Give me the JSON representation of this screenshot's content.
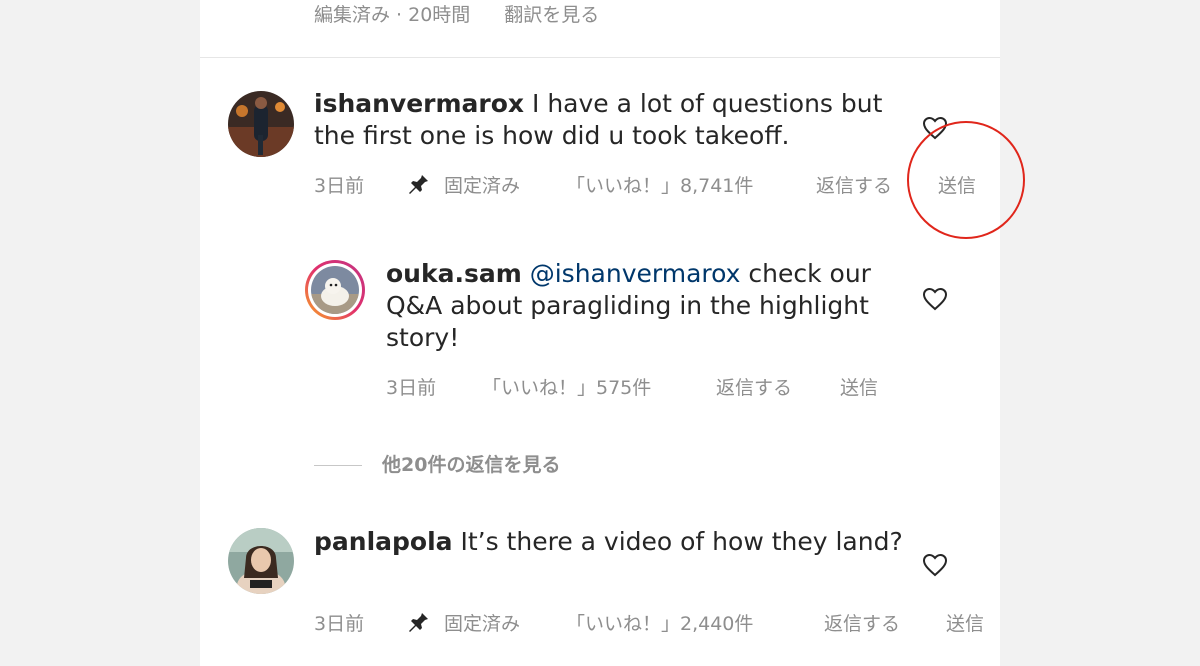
{
  "top_meta": {
    "edited": "編集済み · 20時間",
    "translate": "翻訳を見る"
  },
  "comments": [
    {
      "username": "ishanvermarox",
      "text": " I have a lot of questions but the first one is how did u took takeoff.",
      "time": "3日前",
      "pinned": "固定済み",
      "likes": "「いいね！」8,741件",
      "reply": "返信する",
      "send": "送信"
    },
    {
      "username": "panlapola",
      "text": " It’s there a video of how they land?",
      "time": "3日前",
      "pinned": "固定済み",
      "likes": "「いいね！」2,440件",
      "reply": "返信する",
      "send": "送信"
    }
  ],
  "reply": {
    "username": "ouka.sam",
    "mention": "@ishanvermarox",
    "text": " check our Q&A about paragliding in the highlight story!",
    "time": "3日前",
    "likes": "「いいね！」575件",
    "reply": "返信する",
    "send": "送信"
  },
  "view_more_replies": "他20件の返信を見る",
  "colors": {
    "text": "#262626",
    "meta": "#8e8e8e",
    "mention": "#00376b",
    "highlight": "#e0261b",
    "story_ring_start": "#f9a825",
    "story_ring_end": "#c13584"
  },
  "icons": [
    "heart-icon",
    "pin-icon"
  ]
}
